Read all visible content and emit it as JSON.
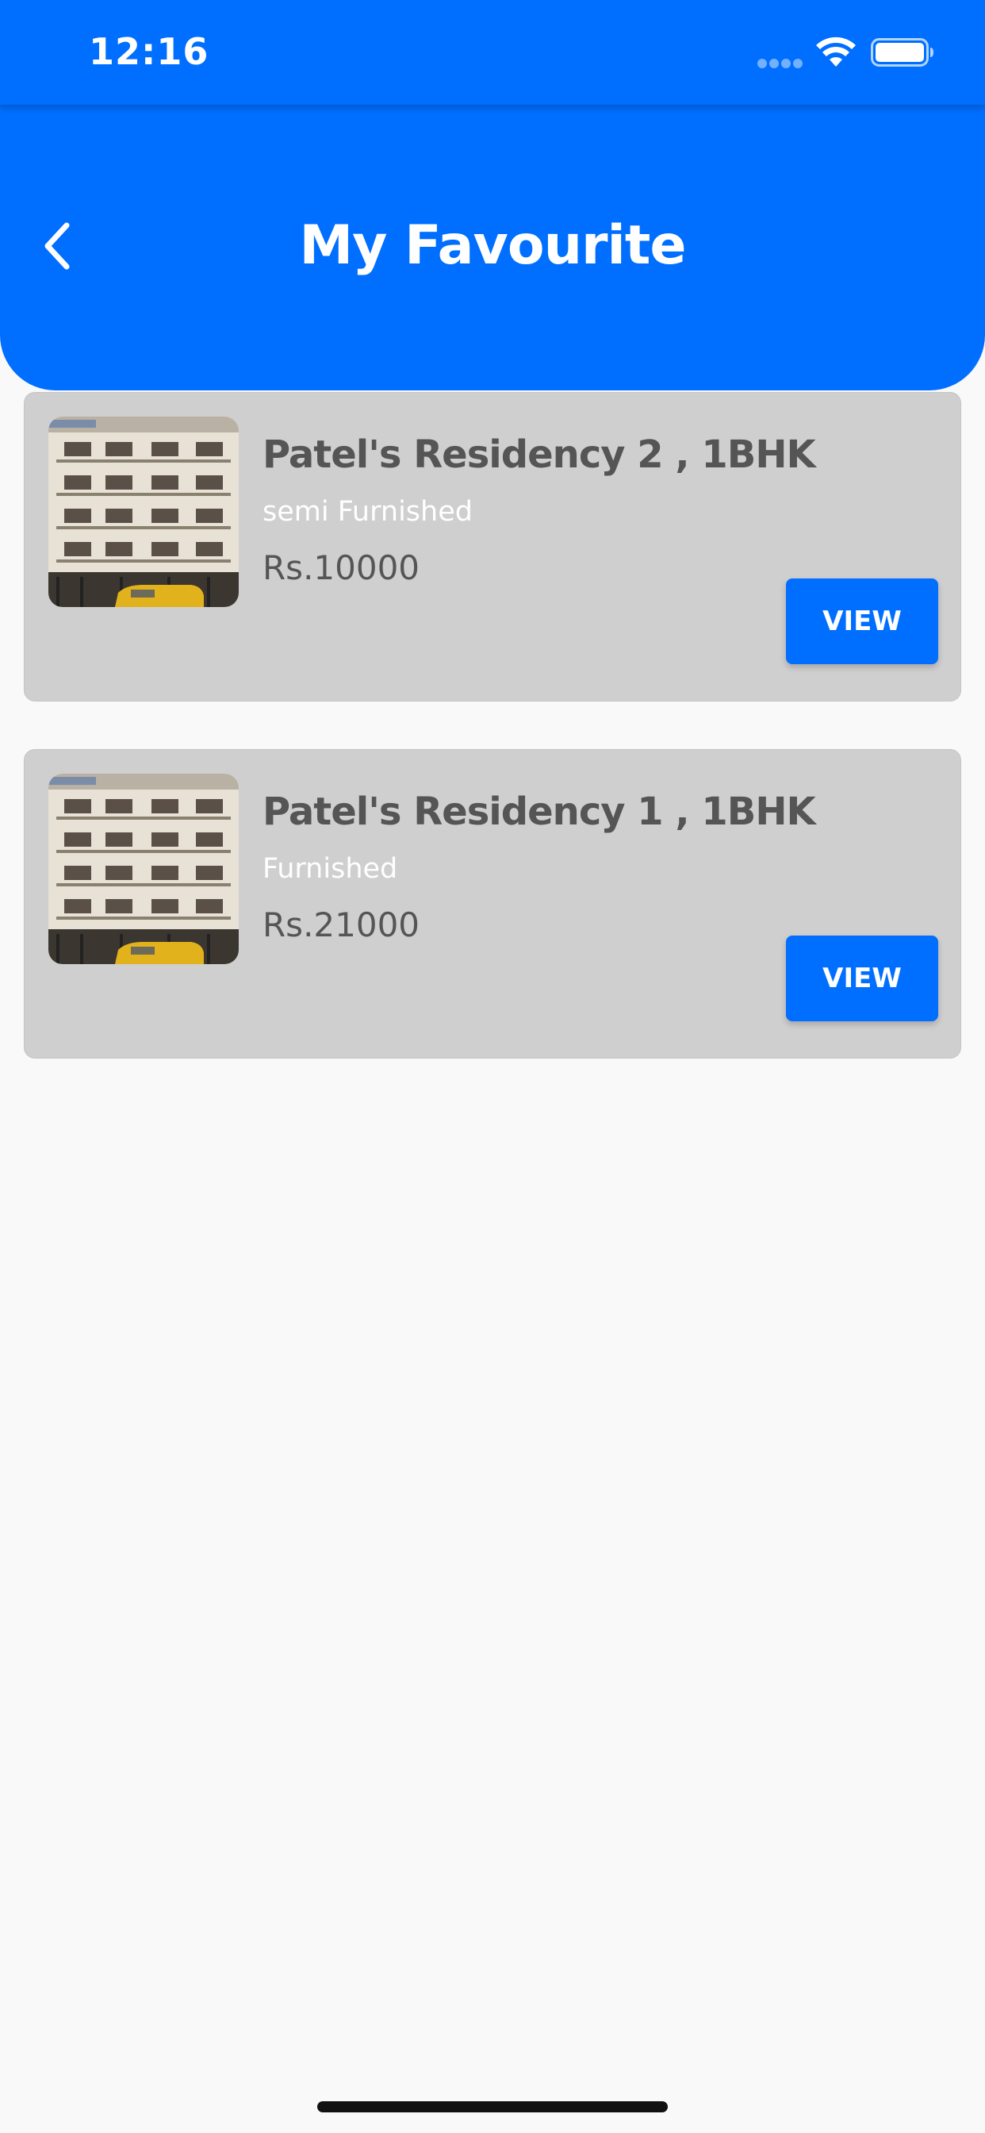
{
  "status_bar": {
    "time": "12:16"
  },
  "header": {
    "title": "My Favourite",
    "back_icon": "chevron-left-icon"
  },
  "favourites": [
    {
      "title": "Patel's Residency 2 , 1BHK",
      "furnishing": "semi Furnished",
      "price": "Rs.10000",
      "button_label": "VIEW"
    },
    {
      "title": "Patel's Residency 1 , 1BHK",
      "furnishing": "Furnished",
      "price": "Rs.21000",
      "button_label": "VIEW"
    }
  ],
  "colors": {
    "primary": "#006fff",
    "card_background": "#cfcfcf",
    "page_background": "#f9f9f9",
    "title_text": "#555555"
  }
}
